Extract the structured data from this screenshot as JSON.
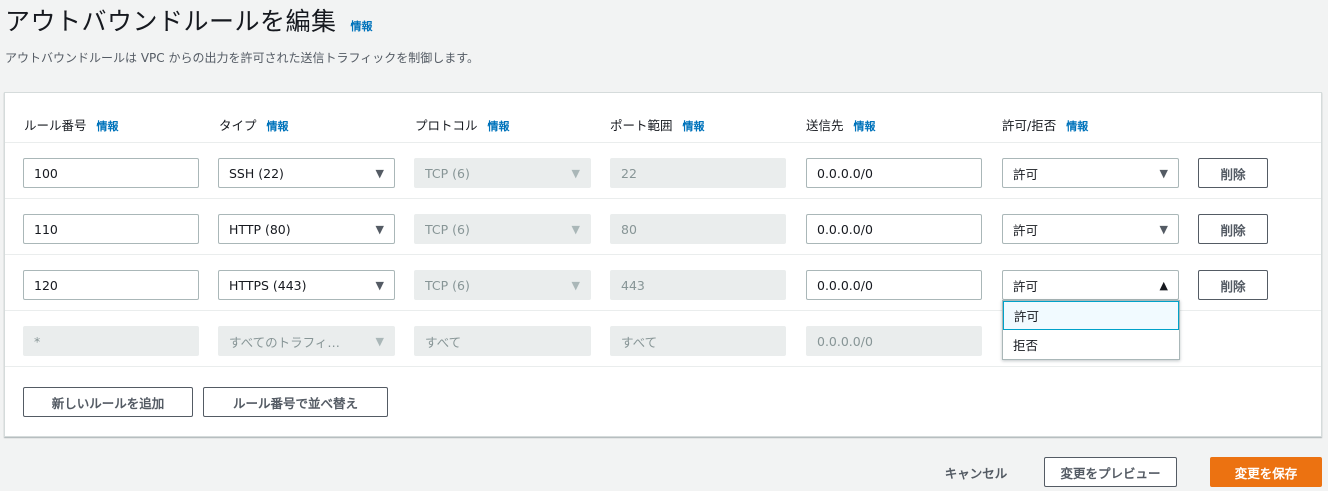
{
  "page": {
    "title": "アウトバウンドルールを編集",
    "info_label": "情報",
    "description": "アウトバウンドルールは VPC からの出力を許可された送信トラフィックを制御します。"
  },
  "columns": [
    {
      "label": "ルール番号",
      "info": "情報"
    },
    {
      "label": "タイプ",
      "info": "情報"
    },
    {
      "label": "プロトコル",
      "info": "情報"
    },
    {
      "label": "ポート範囲",
      "info": "情報"
    },
    {
      "label": "送信先",
      "info": "情報"
    },
    {
      "label": "許可/拒否",
      "info": "情報"
    }
  ],
  "rules": [
    {
      "rule_number": "100",
      "type": "SSH (22)",
      "protocol": "TCP (6)",
      "port_range": "22",
      "destination": "0.0.0.0/0",
      "action": "許可",
      "delete_label": "削除"
    },
    {
      "rule_number": "110",
      "type": "HTTP (80)",
      "protocol": "TCP (6)",
      "port_range": "80",
      "destination": "0.0.0.0/0",
      "action": "許可",
      "delete_label": "削除"
    },
    {
      "rule_number": "120",
      "type": "HTTPS (443)",
      "protocol": "TCP (6)",
      "port_range": "443",
      "destination": "0.0.0.0/0",
      "action": "許可",
      "delete_label": "削除"
    }
  ],
  "default_rule": {
    "rule_number": "*",
    "type": "すべてのトラフィ…",
    "protocol": "すべて",
    "port_range": "すべて",
    "destination": "0.0.0.0/0"
  },
  "action_dropdown": {
    "open_row": 2,
    "options": [
      "許可",
      "拒否"
    ],
    "highlighted": "許可"
  },
  "panel_buttons": {
    "add_rule": "新しいルールを追加",
    "sort_rules": "ルール番号で並べ替え"
  },
  "page_buttons": {
    "cancel": "キャンセル",
    "preview": "変更をプレビュー",
    "save": "変更を保存"
  },
  "colors": {
    "info_link": "#0073bb",
    "primary_button": "#ec7211",
    "disabled_field": "#eaeded"
  },
  "icons": {
    "caret_down": "▼",
    "caret_up": "▲"
  }
}
